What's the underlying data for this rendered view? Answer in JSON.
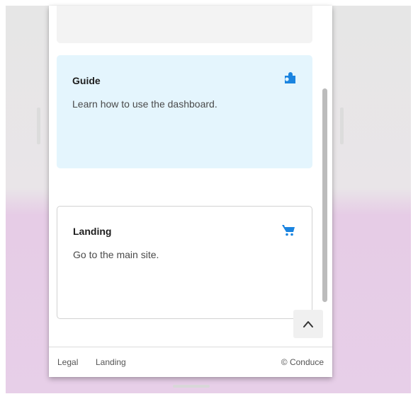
{
  "cards": {
    "guide": {
      "title": "Guide",
      "description": "Learn how to use the dashboard.",
      "icon": "puzzle-icon"
    },
    "landing": {
      "title": "Landing",
      "description": "Go to the main site.",
      "icon": "cart-icon"
    }
  },
  "footer": {
    "legal": "Legal",
    "landing": "Landing",
    "copyright": "© Conduce"
  },
  "scroll_top_icon": "chevron-up-icon",
  "colors": {
    "accent": "#1a84e0",
    "guide_card_bg": "#e4f5fd",
    "backdrop_lower": "#e7cfe8"
  }
}
